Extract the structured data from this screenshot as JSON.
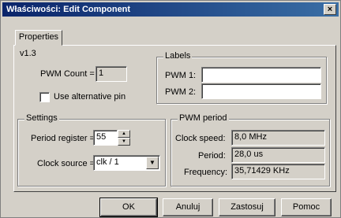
{
  "window": {
    "title": "Właściwości: Edit Component",
    "close_glyph": "×"
  },
  "tabs": [
    {
      "label": "Properties"
    }
  ],
  "version": "v1.3",
  "pwm_count": {
    "label": "PWM Count =",
    "value": "1"
  },
  "alt_pin": {
    "label": "Use alternative pin",
    "checked": false
  },
  "labels_group": {
    "title": "Labels",
    "pwm1": {
      "label": "PWM 1:",
      "value": ""
    },
    "pwm2": {
      "label": "PWM 2:",
      "value": ""
    }
  },
  "settings_group": {
    "title": "Settings",
    "period_register": {
      "label": "Period register =",
      "value": "55"
    },
    "clock_source": {
      "label": "Clock source =",
      "value": "clk / 1"
    }
  },
  "pwm_period_group": {
    "title": "PWM period",
    "clock_speed": {
      "label": "Clock speed:",
      "value": "8,0 MHz"
    },
    "period": {
      "label": "Period:",
      "value": "28,0 us"
    },
    "frequency": {
      "label": "Frequency:",
      "value": "35,71429 KHz"
    }
  },
  "buttons": {
    "ok": "OK",
    "cancel": "Anuluj",
    "apply": "Zastosuj",
    "help": "Pomoc"
  }
}
